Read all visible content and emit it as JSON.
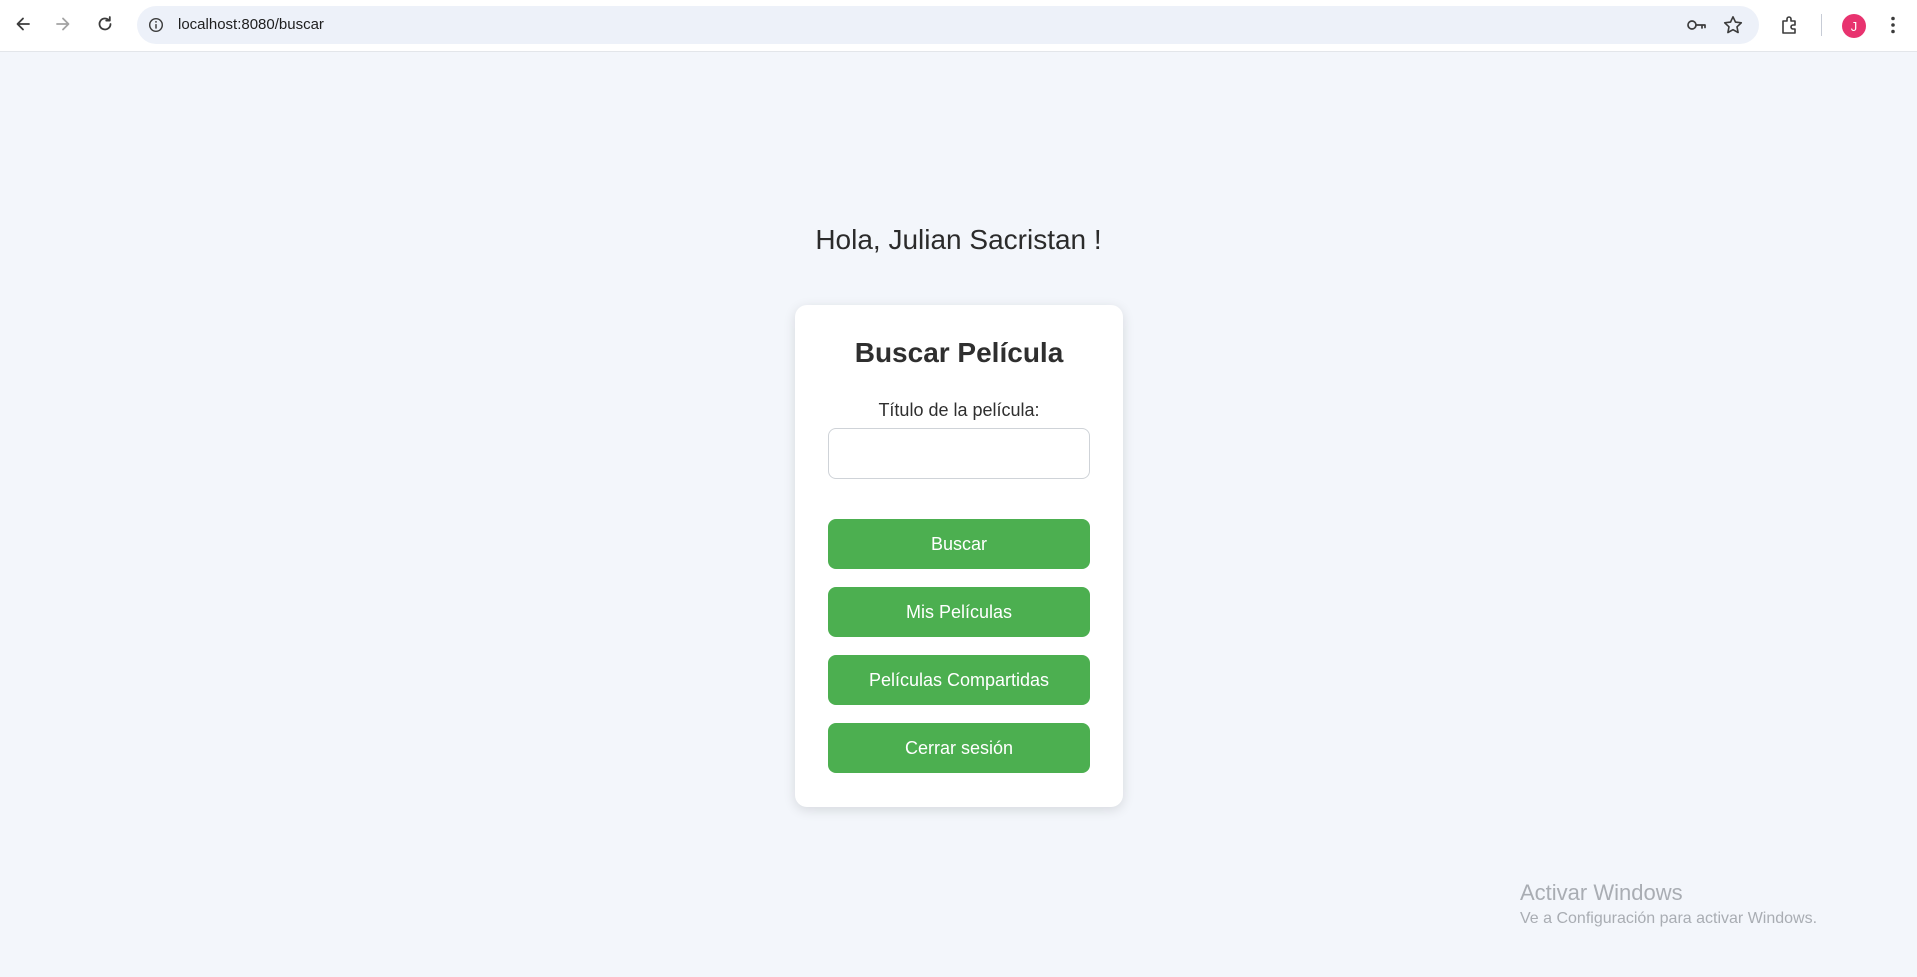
{
  "browser": {
    "url": "localhost:8080/buscar",
    "avatar_letter": "J",
    "avatar_color": "#e8336f"
  },
  "page": {
    "greeting": "Hola, Julian Sacristan !",
    "card": {
      "title": "Buscar Película",
      "field_label": "Título de la película:",
      "input_value": "",
      "buttons": {
        "search": "Buscar",
        "my_movies": "Mis Películas",
        "shared_movies": "Películas Compartidas",
        "logout": "Cerrar sesión"
      }
    },
    "accent_color": "#4caf50"
  },
  "watermark": {
    "title": "Activar Windows",
    "subtitle": "Ve a Configuración para activar Windows."
  }
}
